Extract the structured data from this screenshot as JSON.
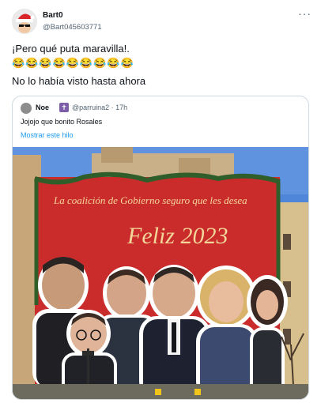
{
  "tweet": {
    "author_name": "Bart0",
    "author_handle": "@Bart045603771",
    "more_icon": "···",
    "line1": "¡Pero qué puta maravilla!.",
    "line2": "😂😂😂😂😂😂😂😂😂",
    "line3": "No lo había visto hasta ahora"
  },
  "quote": {
    "author_name": "Noe",
    "badge": "✝",
    "handle_time": "@parruina2 · 17h",
    "text": "Jojojo que bonito Rosales",
    "show_thread": "Mostrar este hilo"
  },
  "billboard": {
    "headline": "La coalición de Gobierno seguro que les desea",
    "greeting": "Feliz 2023"
  },
  "colors": {
    "link": "#1d9bf0",
    "billboard_red": "#d0302f",
    "sky": "#4f86d9",
    "gold": "#f3d69a"
  }
}
